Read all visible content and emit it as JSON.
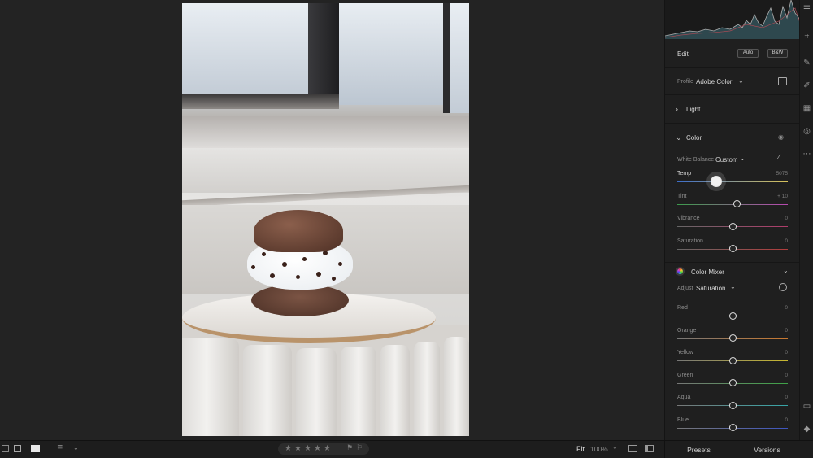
{
  "edit_panel": {
    "title": "Edit",
    "auto_label": "Auto",
    "bw_label": "B&W",
    "profile_label": "Profile",
    "profile_value": "Adobe Color",
    "light_section": "Light",
    "color_section": "Color",
    "white_balance_label": "White Balance",
    "white_balance_value": "Custom",
    "sliders": [
      {
        "label": "Temp",
        "value": "5075",
        "position": 0.35
      },
      {
        "label": "Tint",
        "value": "+ 10",
        "position": 0.54
      },
      {
        "label": "Vibrance",
        "value": "0",
        "position": 0.5
      },
      {
        "label": "Saturation",
        "value": "0",
        "position": 0.5
      }
    ],
    "color_mixer_section": "Color Mixer",
    "adjust_label": "Adjust",
    "adjust_value": "Saturation",
    "mixer_sliders": [
      {
        "label": "Red",
        "value": "0",
        "position": 0.5
      },
      {
        "label": "Orange",
        "value": "0",
        "position": 0.5
      },
      {
        "label": "Yellow",
        "value": "0",
        "position": 0.5
      },
      {
        "label": "Green",
        "value": "0",
        "position": 0.5
      },
      {
        "label": "Aqua",
        "value": "0",
        "position": 0.5
      },
      {
        "label": "Blue",
        "value": "0",
        "position": 0.5
      }
    ]
  },
  "bottom_bar": {
    "stars": [
      "★",
      "★",
      "★",
      "★",
      "★"
    ],
    "fit_label": "Fit",
    "zoom_label": "100%",
    "presets_tab": "Presets",
    "versions_tab": "Versions"
  },
  "colors": {
    "accent": "#e3e3e3",
    "panel_bg": "#1f1f1f",
    "canvas_bg": "#232323"
  }
}
